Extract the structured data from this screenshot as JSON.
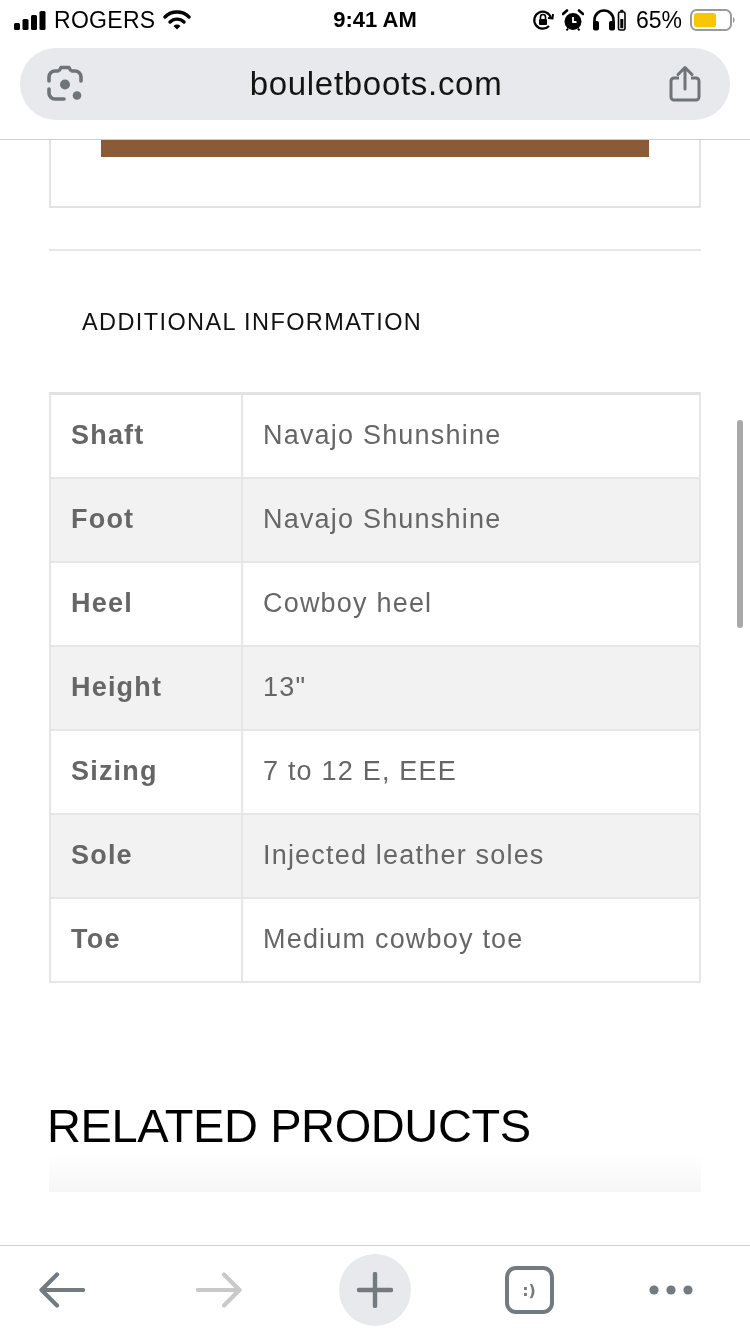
{
  "status_bar": {
    "carrier": "ROGERS",
    "time": "9:41 AM",
    "battery_percent": "65%"
  },
  "address_bar": {
    "url": "bouletboots.com"
  },
  "additional_information": {
    "title": "ADDITIONAL INFORMATION",
    "rows": [
      {
        "label": "Shaft",
        "value": "Navajo Shunshine"
      },
      {
        "label": "Foot",
        "value": "Navajo Shunshine"
      },
      {
        "label": "Heel",
        "value": "Cowboy heel"
      },
      {
        "label": "Height",
        "value": "13\""
      },
      {
        "label": "Sizing",
        "value": "7 to 12 E, EEE"
      },
      {
        "label": "Sole",
        "value": "Injected leather soles"
      },
      {
        "label": "Toe",
        "value": "Medium cowboy toe"
      }
    ]
  },
  "related_products": {
    "title": "RELATED PRODUCTS"
  },
  "toolbar": {
    "items": [
      {
        "kind": "back",
        "disabled": false
      },
      {
        "kind": "forward",
        "disabled": true
      },
      {
        "kind": "new_tab",
        "disabled": false
      },
      {
        "kind": "tab_switcher",
        "label": ":)",
        "disabled": false
      },
      {
        "kind": "more",
        "disabled": false
      }
    ]
  }
}
